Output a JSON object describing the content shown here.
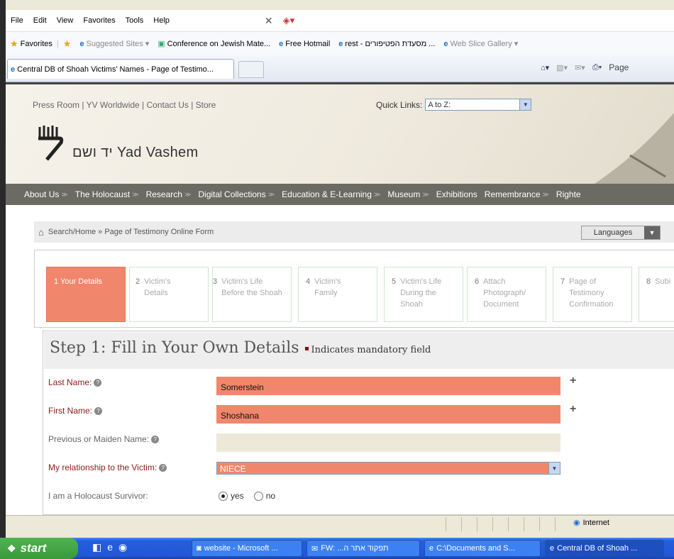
{
  "menu": [
    "File",
    "Edit",
    "View",
    "Favorites",
    "Tools",
    "Help"
  ],
  "favorites": {
    "label": "Favorites",
    "items": [
      {
        "label": "Suggested Sites ▾"
      },
      {
        "label": "Conference on Jewish Mate..."
      },
      {
        "label": "Free Hotmail"
      },
      {
        "label": "rest - מסעדת הפטיפורים ..."
      },
      {
        "label": "Web Slice Gallery ▾"
      }
    ]
  },
  "tab": {
    "title": "Central DB of Shoah Victims' Names - Page of Testimo..."
  },
  "toolbar_right": {
    "page_label": "Page"
  },
  "header": {
    "links": "Press Room | YV Worldwide | Contact Us | Store",
    "quick_links_label": "Quick Links:",
    "quick_links_value": "A to Z:",
    "logo_text": "יד ושם  Yad Vashem"
  },
  "nav": [
    "About Us",
    "The Holocaust",
    "Research",
    "Digital Collections",
    "Education & E-Learning",
    "Museum",
    "Exhibitions",
    "Remembrance",
    "Righte"
  ],
  "breadcrumb": "Search/Home » Page of Testimony Online Form",
  "languages": "Languages",
  "steps": [
    {
      "num": "1",
      "label": "Your Details"
    },
    {
      "num": "2",
      "label": "Victim's Details"
    },
    {
      "num": "3",
      "label": "Victim's Life Before the Shoah"
    },
    {
      "num": "4",
      "label": "Victim's Family"
    },
    {
      "num": "5",
      "label": "Victim's Life During the Shoah"
    },
    {
      "num": "6",
      "label": "Attach Photograph/ Document"
    },
    {
      "num": "7",
      "label": "Page of Testimony Confirmation"
    },
    {
      "num": "8",
      "label": "Subi"
    }
  ],
  "form": {
    "title": "Step 1: Fill in Your Own Details",
    "mandatory_note": "Indicates mandatory field",
    "last_name_label": "Last Name:",
    "last_name_value": "Somerstein",
    "first_name_label": "First Name:",
    "first_name_value": "Shoshana",
    "maiden_label": "Previous or Maiden Name:",
    "maiden_value": "",
    "relationship_label": "My relationship to the Victim:",
    "relationship_value": "NIECE",
    "survivor_label": "I am a Holocaust Survivor:",
    "yes": "yes",
    "no": "no",
    "survivor_selected": "yes"
  },
  "status": {
    "zone": "Internet"
  },
  "taskbar": {
    "start": "start",
    "items": [
      {
        "label": "website - Microsoft ..."
      },
      {
        "label": "FW: ...תפקוד אתר ה"
      },
      {
        "label": "C:\\Documents and S..."
      },
      {
        "label": "Central DB of Shoah ..."
      }
    ]
  },
  "colors": {
    "accent": "#f0876c",
    "nav_bg": "#6b6b63",
    "required": "#8b1a1a"
  }
}
